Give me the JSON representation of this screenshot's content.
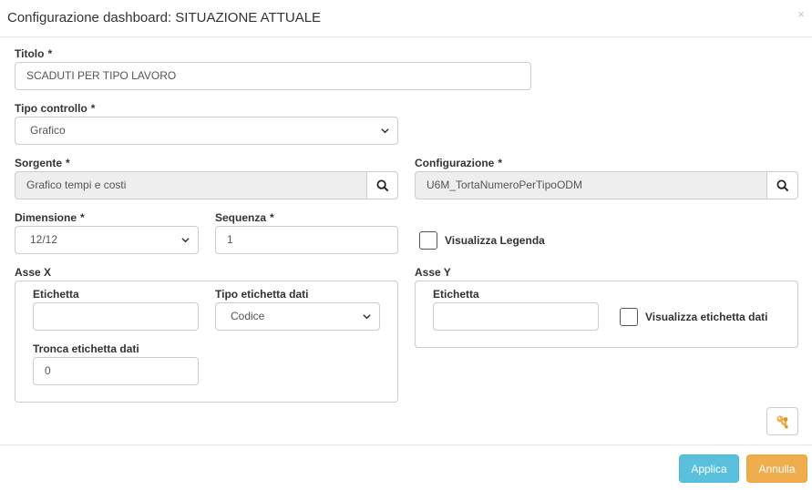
{
  "modal": {
    "title": "Configurazione dashboard: SITUAZIONE ATTUALE",
    "close_label": "×"
  },
  "required_mark": "*",
  "fields": {
    "titolo": {
      "label": "Titolo",
      "value": "SCADUTI PER TIPO LAVORO"
    },
    "tipo_controllo": {
      "label": "Tipo controllo",
      "value": "Grafico"
    },
    "sorgente": {
      "label": "Sorgente",
      "value": "Grafico tempi e costi"
    },
    "configurazione": {
      "label": "Configurazione",
      "value": "U6M_TortaNumeroPerTipoODM"
    },
    "dimensione": {
      "label": "Dimensione",
      "value": "12/12"
    },
    "sequenza": {
      "label": "Sequenza",
      "value": "1"
    },
    "visualizza_legenda": {
      "label": "Visualizza Legenda",
      "checked": false
    }
  },
  "asse_x": {
    "title": "Asse X",
    "etichetta": {
      "label": "Etichetta",
      "value": ""
    },
    "tipo_etichetta": {
      "label": "Tipo etichetta dati",
      "value": "Codice"
    },
    "tronca": {
      "label": "Tronca etichetta dati",
      "value": "0"
    }
  },
  "asse_y": {
    "title": "Asse Y",
    "etichetta": {
      "label": "Etichetta",
      "value": ""
    },
    "visualizza_etichetta": {
      "label": "Visualizza etichetta dati",
      "checked": false
    }
  },
  "icons": {
    "search": "search-icon",
    "key": "key-icon",
    "chevron": "chevron-down-icon"
  },
  "colors": {
    "apply": "#5bc0de",
    "cancel": "#f0ad4e",
    "key": "#f0ad4e"
  },
  "footer": {
    "apply_label": "Applica",
    "cancel_label": "Annulla"
  }
}
